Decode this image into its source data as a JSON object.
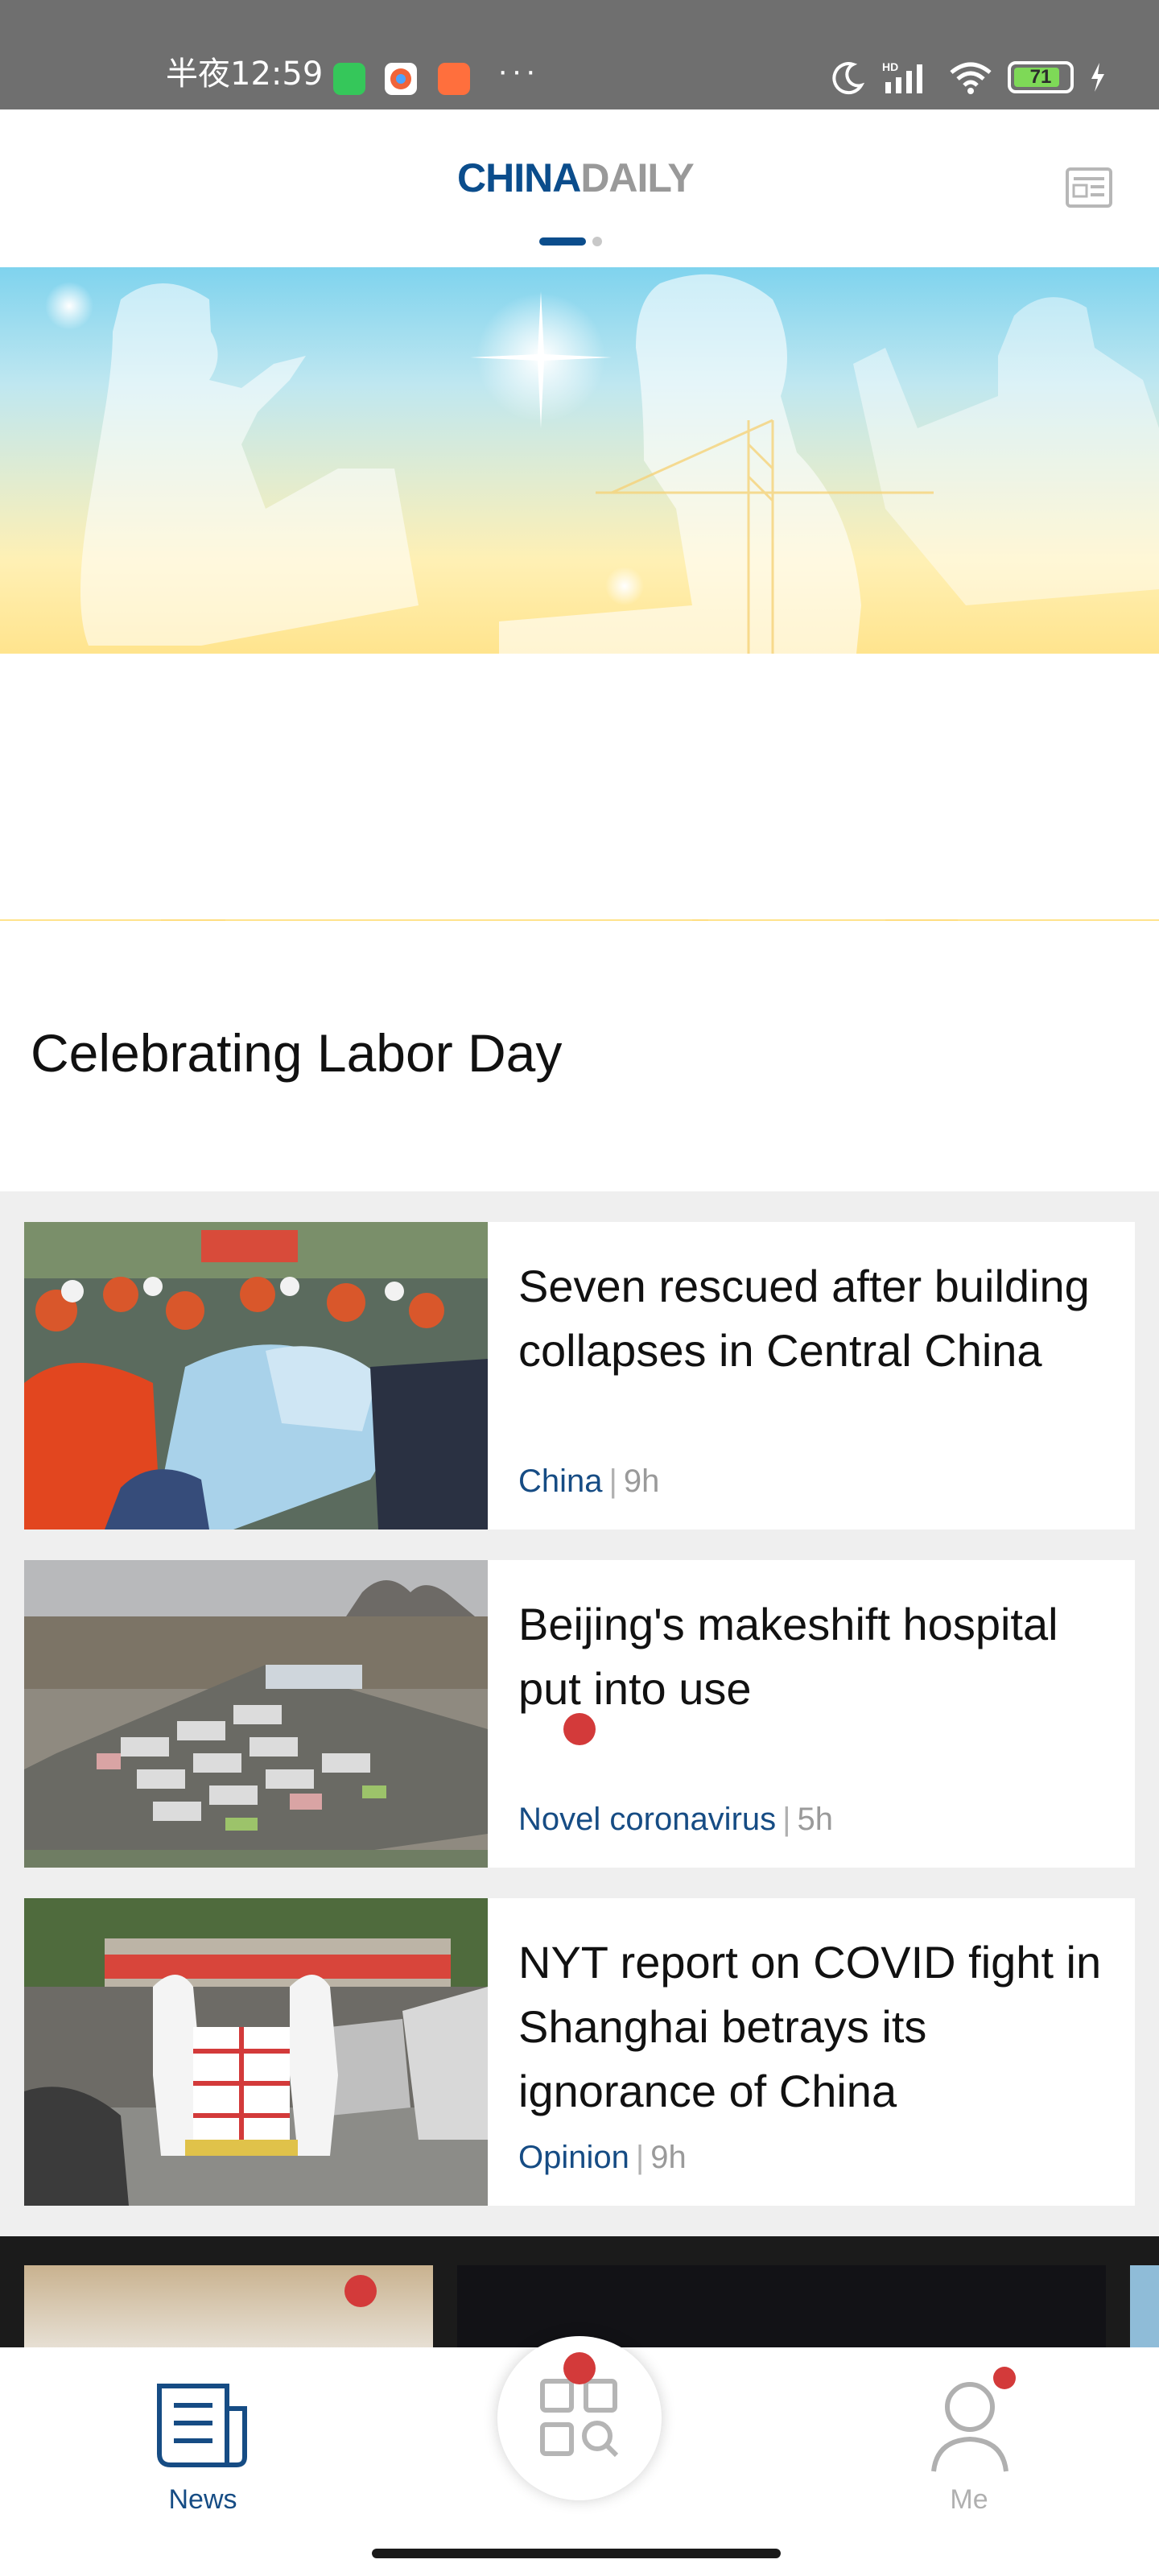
{
  "status_bar": {
    "time": "半夜12:59",
    "dots": "···",
    "hd_label": "HD",
    "battery": "71"
  },
  "header": {
    "logo_china": "CHINA",
    "logo_daily": "DAILY",
    "menu_icon": "newspaper-icon",
    "pager_active_index": 0,
    "pager_count": 2
  },
  "hero": {
    "title": "Celebrating Labor Day"
  },
  "articles": [
    {
      "title": "Seven rescued after building collapses in Central China",
      "category": "China",
      "separator": "|",
      "time": "9h"
    },
    {
      "title": "Beijing's makeshift hospital put into use",
      "category": "Novel coronavirus",
      "separator": "|",
      "time": "5h"
    },
    {
      "title": "NYT report on COVID fight in Shanghai betrays its ignorance of China",
      "category": "Opinion",
      "separator": "|",
      "time": "9h"
    }
  ],
  "bottom_nav": {
    "news": "News",
    "me": "Me",
    "active_color": "#164c84",
    "inactive_color": "#b0b0b0",
    "badge_color": "#d33a3a"
  }
}
